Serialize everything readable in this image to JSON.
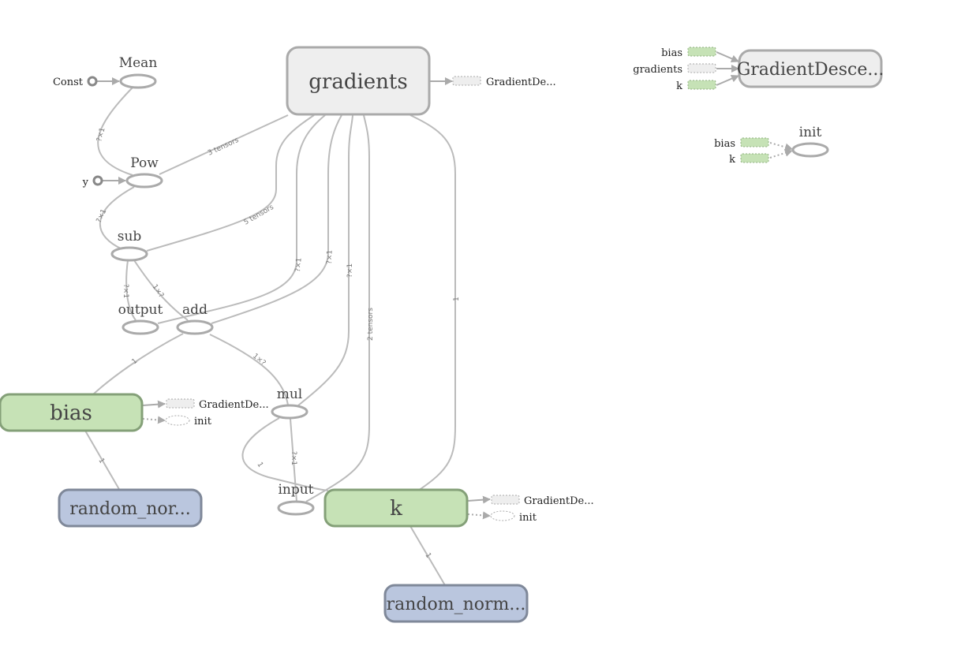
{
  "nodes": {
    "gradients": "gradients",
    "mean": "Mean",
    "const": "Const",
    "pow": "Pow",
    "y": "y",
    "sub": "sub",
    "output": "output",
    "add": "add",
    "mul": "mul",
    "input": "input",
    "bias": "bias",
    "k": "k",
    "random_bias": "random_nor...",
    "random_k": "random_norm...",
    "gradient_descent": "GradientDesce...",
    "init": "init"
  },
  "stubs": {
    "gradients_out": "GradientDe...",
    "bias_gd": "GradientDe...",
    "bias_init": "init",
    "k_gd": "GradientDe...",
    "k_init": "init",
    "gd_in_bias": "bias",
    "gd_in_gradients": "gradients",
    "gd_in_k": "k",
    "init_in_bias": "bias",
    "init_in_k": "k"
  },
  "edge_labels": {
    "mean_pow": "?×1",
    "pow_sub": "?×1",
    "pow_grad": "3 tensors",
    "sub_grad": "5 tensors",
    "sub_output": "?×1",
    "sub_add": "1×?",
    "grad_add1": "?×1",
    "grad_add2": "?×1",
    "grad_mul": "?×1",
    "grad_input": "2 tensors",
    "grad_k": "1",
    "add_bias": "1",
    "add_mul": "1×?",
    "bias_random": "1",
    "mul_input": "?×1",
    "mul_k": "1",
    "k_random": "1"
  }
}
